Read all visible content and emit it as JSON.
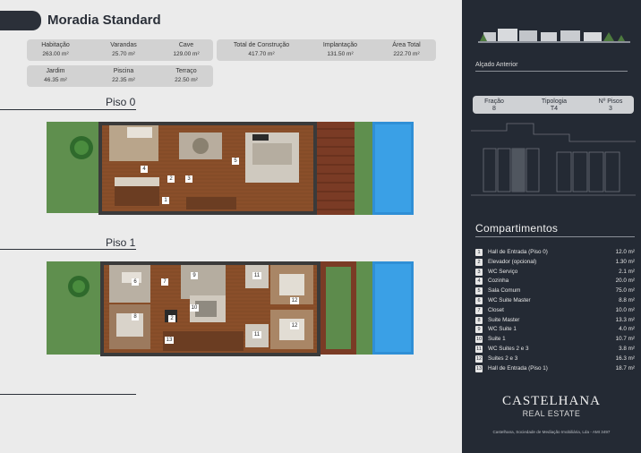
{
  "title": "Moradia Standard",
  "stats_row1": [
    {
      "label": "Habitação",
      "value": "263.00 m²"
    },
    {
      "label": "Varandas",
      "value": "25.70 m²"
    },
    {
      "label": "Cave",
      "value": "129.00 m²"
    },
    {
      "label": "Total de Construção",
      "value": "417.70 m²"
    },
    {
      "label": "Implantação",
      "value": "131.50 m²"
    },
    {
      "label": "Área Total",
      "value": "222.70 m²"
    }
  ],
  "stats_row2": [
    {
      "label": "Jardim",
      "value": "46.35 m²"
    },
    {
      "label": "Piscina",
      "value": "22.35 m²"
    },
    {
      "label": "Terraço",
      "value": "22.50 m²"
    }
  ],
  "floors": [
    {
      "title": "Piso 0"
    },
    {
      "title": "Piso 1"
    }
  ],
  "plan_labels": {
    "piso0": [
      "1",
      "2",
      "3",
      "4",
      "5"
    ],
    "piso1": [
      "6",
      "7",
      "8",
      "9",
      "10",
      "11",
      "2",
      "13",
      "12",
      "12",
      "11"
    ]
  },
  "alcado_label": "Alçado Anterior",
  "info": [
    {
      "label": "Fração",
      "value": "8"
    },
    {
      "label": "Tipologia",
      "value": "T4"
    },
    {
      "label": "Nº Pisos",
      "value": "3"
    }
  ],
  "compartimentos_title": "Compartimentos",
  "compartimentos": [
    {
      "num": "1",
      "name": "Hall de Entrada (Piso 0)",
      "area": "12.0 m²"
    },
    {
      "num": "2",
      "name": "Elevador (opcional)",
      "area": "1.30 m²"
    },
    {
      "num": "3",
      "name": "WC Serviço",
      "area": "2.1 m²"
    },
    {
      "num": "4",
      "name": "Cozinha",
      "area": "20.0 m²"
    },
    {
      "num": "5",
      "name": "Sala Comum",
      "area": "75.0 m²"
    },
    {
      "num": "6",
      "name": "WC Suite Master",
      "area": "8.8 m²"
    },
    {
      "num": "7",
      "name": "Closet",
      "area": "10.0 m²"
    },
    {
      "num": "8",
      "name": "Suite Master",
      "area": "13.3 m²"
    },
    {
      "num": "9",
      "name": "WC Suite 1",
      "area": "4.0 m²"
    },
    {
      "num": "10",
      "name": "Suite 1",
      "area": "10.7 m²"
    },
    {
      "num": "11",
      "name": "WC Suites 2 e 3",
      "area": "3.8 m²"
    },
    {
      "num": "12",
      "name": "Suites 2 e 3",
      "area": "16.3 m²"
    },
    {
      "num": "13",
      "name": "Hall de Entrada (Piso 1)",
      "area": "18.7 m²"
    }
  ],
  "brand": {
    "line1": "CASTELHANA",
    "line2": "REAL ESTATE"
  },
  "footer": "Castelhana, Sociedade de Mediação Imobiliária, Lda - AMI 3497",
  "colors": {
    "dark": "#242a34",
    "wood": "#8a4f2a",
    "pool": "#2f8fd6",
    "grass": "#5f8f4e"
  }
}
